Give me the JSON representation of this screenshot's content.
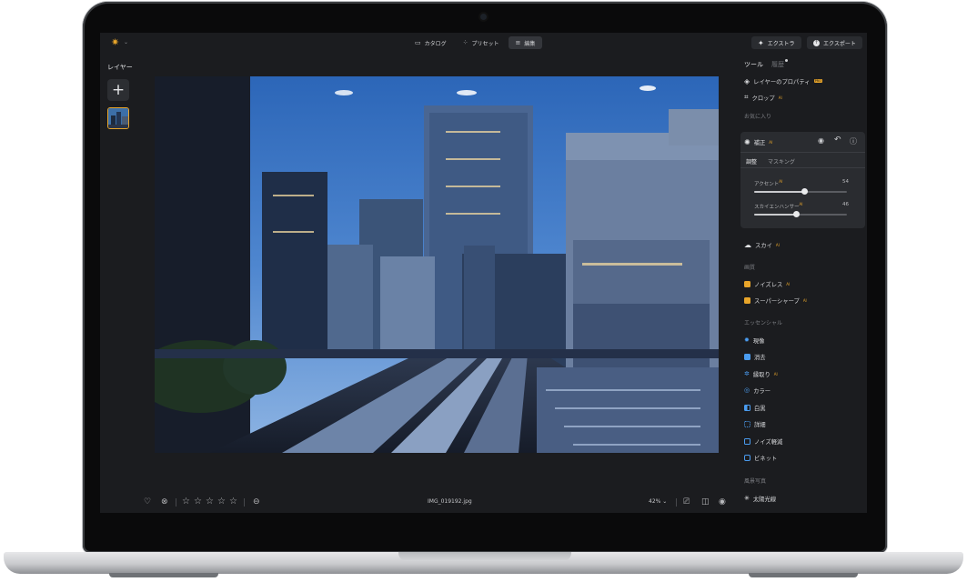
{
  "topbar": {
    "tabs": [
      {
        "label": "カタログ",
        "icon": "catalog-icon"
      },
      {
        "label": "プリセット",
        "icon": "presets-icon"
      },
      {
        "label": "編集",
        "icon": "edit-sliders-icon",
        "active": true
      }
    ],
    "extras_label": "エクストラ",
    "export_label": "エクスポート"
  },
  "layers": {
    "title": "レイヤー",
    "add_label": "+"
  },
  "bottombar": {
    "filename": "IMG_019192.jpg",
    "zoom": "42%",
    "rating": 0
  },
  "right_panel": {
    "tabs": {
      "tools": "ツール",
      "history": "履歴"
    },
    "items_top": [
      {
        "label": "レイヤーのプロパティ",
        "badge": "PRO",
        "icon": "layers-icon"
      },
      {
        "label": "クロップ",
        "ai": "AI",
        "icon": "crop-icon"
      }
    ],
    "favorites_label": "お気に入り",
    "card": {
      "title": "補正",
      "ai": "AI",
      "tab_adjust": "調整",
      "tab_masking": "マスキング",
      "sliders": [
        {
          "label": "アクセント",
          "ai": "AI",
          "value": "54",
          "fraction": 0.54
        },
        {
          "label": "スカイエンハンサー",
          "ai": "AI",
          "value": "46",
          "fraction": 0.46
        }
      ]
    },
    "sky_label": "スカイ",
    "sky_ai": "AI",
    "quality_section": "画質",
    "quality_items": [
      {
        "label": "ノイズレス",
        "ai": "AI"
      },
      {
        "label": "スーパーシャープ",
        "ai": "AI"
      }
    ],
    "essentials_section": "エッセンシャル",
    "essential_items": [
      {
        "label": "現像",
        "color": "#4a9cf0"
      },
      {
        "label": "消去",
        "color": "#4a9cf0"
      },
      {
        "label": "縁取り",
        "ai": "AI",
        "color": "#4a9cf0"
      },
      {
        "label": "カラー",
        "color": "#4a9cf0"
      },
      {
        "label": "白黒",
        "color": "#4a9cf0"
      },
      {
        "label": "詳細",
        "color": "#4a9cf0"
      },
      {
        "label": "ノイズ軽減",
        "color": "#4a9cf0"
      },
      {
        "label": "ビネット",
        "color": "#4a9cf0"
      }
    ],
    "landscape_section": "風景写真",
    "landscape_items": [
      {
        "label": "太陽光線"
      }
    ]
  },
  "colors": {
    "accent": "#e8a52a",
    "panel": "#1b1c1f",
    "card": "#2a2c30",
    "tool_blue": "#4a9cf0"
  }
}
